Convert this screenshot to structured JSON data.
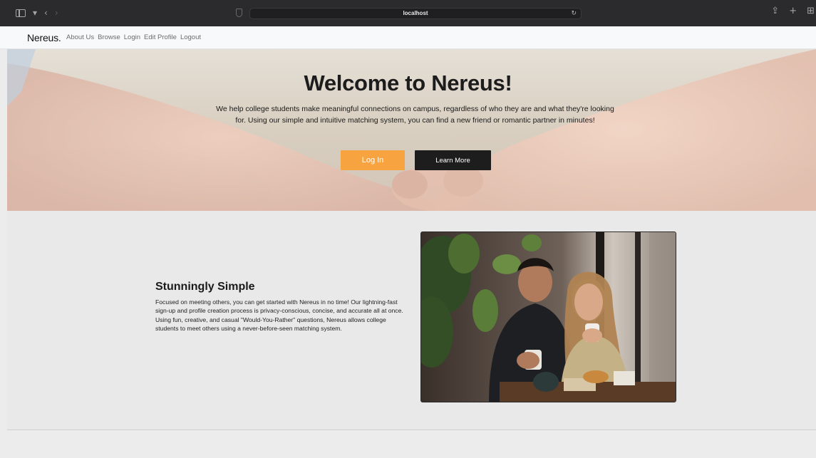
{
  "browser": {
    "url": "localhost"
  },
  "navbar": {
    "brand": "Nereus.",
    "links": [
      "About Us",
      "Browse",
      "Login",
      "Edit Profile",
      "Logout"
    ]
  },
  "hero": {
    "title": "Welcome to Nereus!",
    "text": "We help college students make meaningful connections on campus, regardless of who they are and what they're looking for. Using our simple and intuitive matching system, you can find a new friend or romantic partner in minutes!",
    "login_button": "Log In",
    "learn_button": "Learn More"
  },
  "feature": {
    "title": "Stunningly Simple",
    "text": "Focused on meeting others, you can get started with Nereus in no time! Our lightning-fast sign-up and profile creation process is privacy-conscious, concise, and accurate all at once. Using fun, creative, and casual \"Would-You-Rather\" questions, Nereus allows college students to meet others using a never-before-seen matching system."
  },
  "colors": {
    "accent": "#f7a440",
    "dark_button": "#1d1d1d",
    "navbar_bg": "#f8f9fa",
    "chrome_bg": "#2b2b2d"
  },
  "icons": [
    "sidebar-icon",
    "chevron-down-icon",
    "back-icon",
    "forward-icon",
    "shield-icon",
    "reload-icon",
    "share-icon",
    "new-tab-icon",
    "tab-overview-icon"
  ]
}
